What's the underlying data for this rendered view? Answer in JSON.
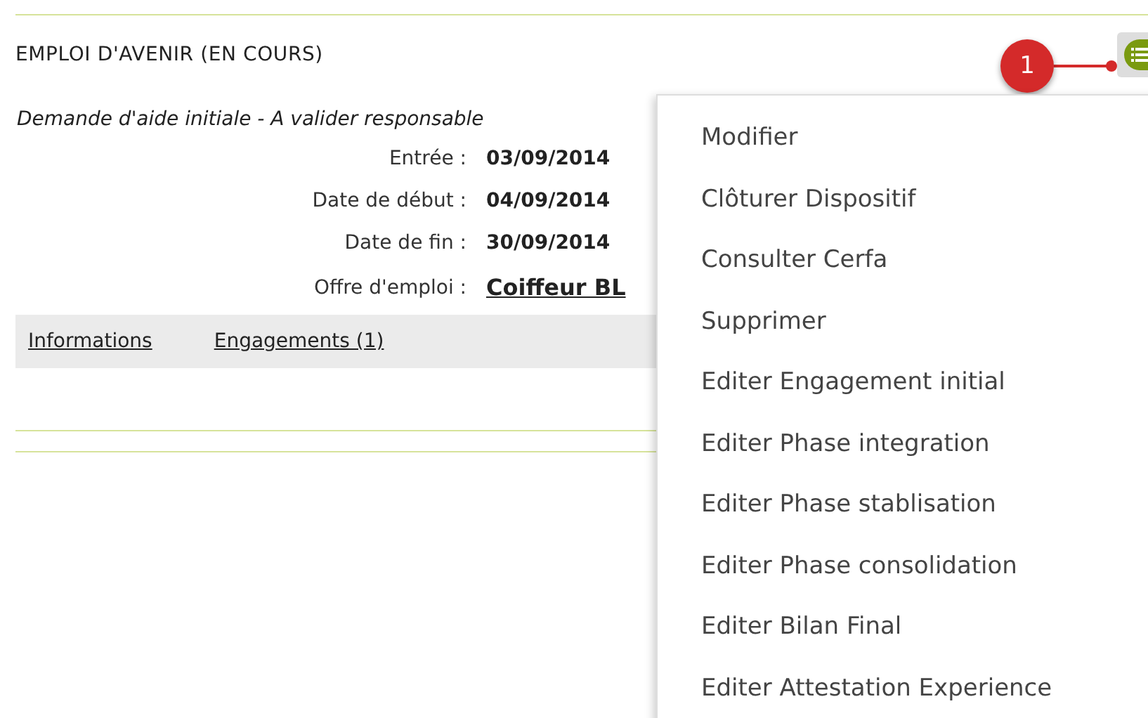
{
  "section": {
    "title": "EMPLOI D'AVENIR (EN COURS)",
    "subtitle": "Demande d'aide initiale  - A valider responsable"
  },
  "callout": {
    "label": "1"
  },
  "fields": [
    {
      "label": "Entrée :",
      "value": "03/09/2014",
      "kind": "text"
    },
    {
      "label": "Date de début :",
      "value": "04/09/2014",
      "kind": "text"
    },
    {
      "label": "Date de fin :",
      "value": "30/09/2014",
      "kind": "text"
    },
    {
      "label": "Offre d'emploi :",
      "value": "Coiffeur BL",
      "kind": "link"
    }
  ],
  "tabs": [
    {
      "label": "Informations"
    },
    {
      "label": "Engagements (1)"
    }
  ],
  "menu": {
    "items": [
      {
        "label": "Modifier"
      },
      {
        "label": "Clôturer Dispositif"
      },
      {
        "label": "Consulter Cerfa"
      },
      {
        "label": "Supprimer"
      },
      {
        "label": "Editer Engagement initial"
      },
      {
        "label": "Editer Phase integration"
      },
      {
        "label": "Editer Phase stablisation"
      },
      {
        "label": "Editer Phase consolidation"
      },
      {
        "label": "Editer Bilan Final"
      },
      {
        "label": "Editer Attestation Experience"
      }
    ]
  }
}
